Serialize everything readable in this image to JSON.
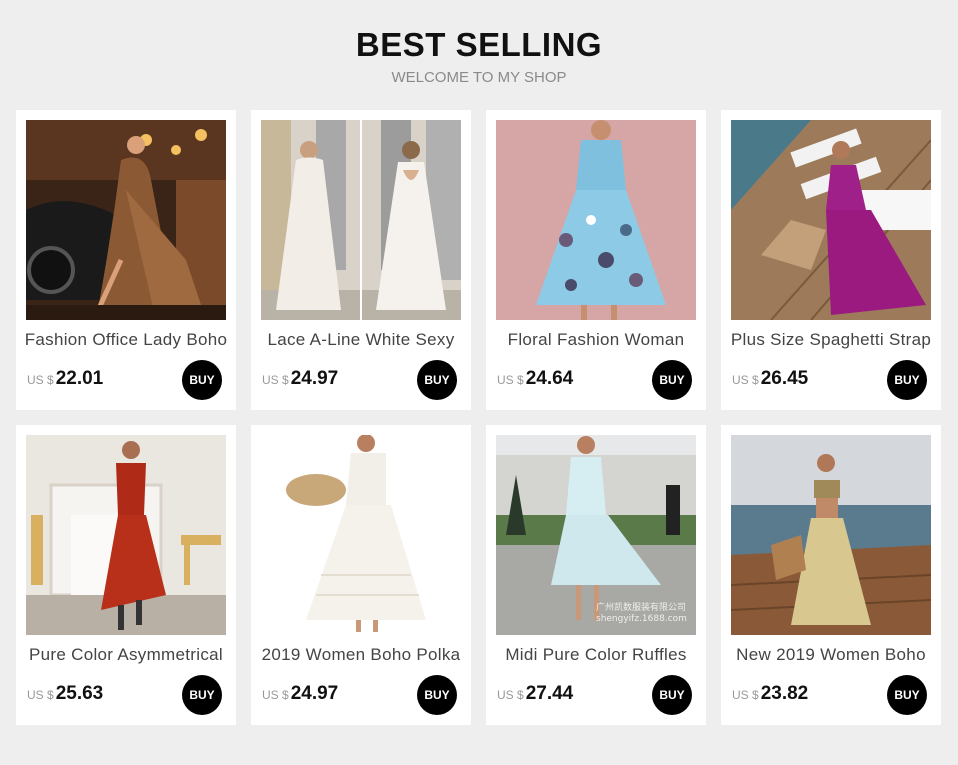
{
  "header": {
    "title": "BEST SELLING",
    "subtitle": "WELCOME TO MY SHOP"
  },
  "products": [
    {
      "name": "Fashion Office Lady Boho",
      "currency": "US $",
      "price": "22.01",
      "buy_label": "BUY"
    },
    {
      "name": "Lace A-Line White Sexy",
      "currency": "US $",
      "price": "24.97",
      "buy_label": "BUY"
    },
    {
      "name": "Floral Fashion Woman",
      "currency": "US $",
      "price": "24.64",
      "buy_label": "BUY"
    },
    {
      "name": "Plus Size Spaghetti Strap",
      "currency": "US $",
      "price": "26.45",
      "buy_label": "BUY"
    },
    {
      "name": "Pure Color Asymmetrical",
      "currency": "US $",
      "price": "25.63",
      "buy_label": "BUY"
    },
    {
      "name": "2019 Women Boho Polka",
      "currency": "US $",
      "price": "24.97",
      "buy_label": "BUY"
    },
    {
      "name": "Midi Pure Color Ruffles",
      "currency": "US $",
      "price": "27.44",
      "buy_label": "BUY"
    },
    {
      "name": "New 2019 Women Boho",
      "currency": "US $",
      "price": "23.82",
      "buy_label": "BUY"
    }
  ],
  "watermark": "广州凯数服装有限公司\nshengyifz.1688.com",
  "colors": {
    "background": "#eeeeee",
    "card": "#ffffff",
    "buy_button": "#000000"
  }
}
